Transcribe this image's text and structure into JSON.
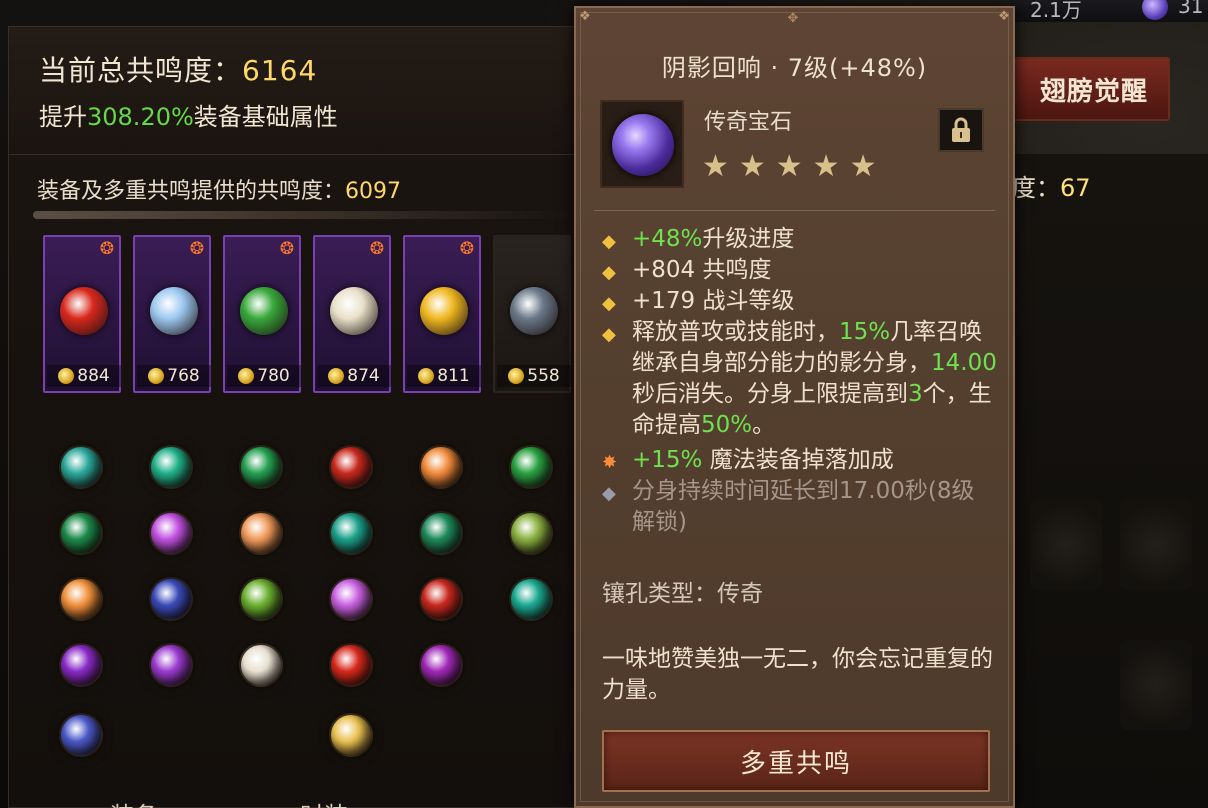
{
  "top": {
    "stat_right": "2.1万",
    "stat_far": "31"
  },
  "wings_button": "翅膀觉醒",
  "right_panel": {
    "label": "度：",
    "value": "67"
  },
  "panel": {
    "total_label": "当前总共鸣度：",
    "total_value": "6164",
    "boost_prefix": "提升",
    "boost_pct": "308.20%",
    "boost_suffix": "装备基础属性",
    "provided_label": "装备及多重共鸣提供的共鸣度：",
    "provided_value": "6097"
  },
  "slots": [
    {
      "value": "884",
      "gem_color": "#d8281c"
    },
    {
      "value": "768",
      "gem_color": "#9cc8f0"
    },
    {
      "value": "780",
      "gem_color": "#38a83a"
    },
    {
      "value": "874",
      "gem_color": "#e8e0c8"
    },
    {
      "value": "811",
      "gem_color": "#f0b820"
    },
    {
      "value": "558",
      "gem_color": "#6a7888"
    }
  ],
  "gems": [
    [
      "#2aa89a",
      "#1fb088",
      "#23a050",
      "#c8281e",
      "#f08a3a",
      "#28a040"
    ],
    [
      "#1c8a4a",
      "#c050e0",
      "#f09a5a",
      "#1aa08a",
      "#1c8a5a",
      "#8ab040"
    ],
    [
      "#f0903a",
      "#3a4ab8",
      "#6ab030",
      "#c860e0",
      "#c8281e",
      "#1aa890"
    ],
    [
      "#8a2ac8",
      "#9a3ad0",
      "#e8e0d0",
      "#d8281c",
      "#a028b8",
      ""
    ],
    [
      "#4a58c8",
      "",
      "",
      "#e8c050",
      "",
      ""
    ]
  ],
  "tabs": {
    "equipment": "装备",
    "fashion": "时装"
  },
  "tooltip": {
    "title": "阴影回响 · 7级(+48%)",
    "subtitle": "传奇宝石",
    "stars": "★★★★★",
    "attrs": [
      {
        "pre": "",
        "green": "+48%",
        "post": "升级进度"
      },
      {
        "pre": "",
        "green": "",
        "post": "+804 共鸣度"
      },
      {
        "pre": "",
        "green": "",
        "post": "+179 战斗等级"
      }
    ],
    "skill": {
      "p1": "释放普攻或技能时，",
      "g1": "15%",
      "p2": "几率召唤继承自身部分能力的影分身，",
      "g2": "14.00",
      "p3": "秒后消失。分身上限提高到",
      "g3": "3",
      "p4": "个，生命提高",
      "g4": "50%",
      "p5": "。"
    },
    "magic_green": "+15%",
    "magic_text": " 魔法装备掉落加成",
    "locked_text": "分身持续时间延长到17.00秒(8级解锁)",
    "socket": "镶孔类型：传奇",
    "flavor": "一味地赞美独一无二，你会忘记重复的力量。",
    "button": "多重共鸣"
  }
}
